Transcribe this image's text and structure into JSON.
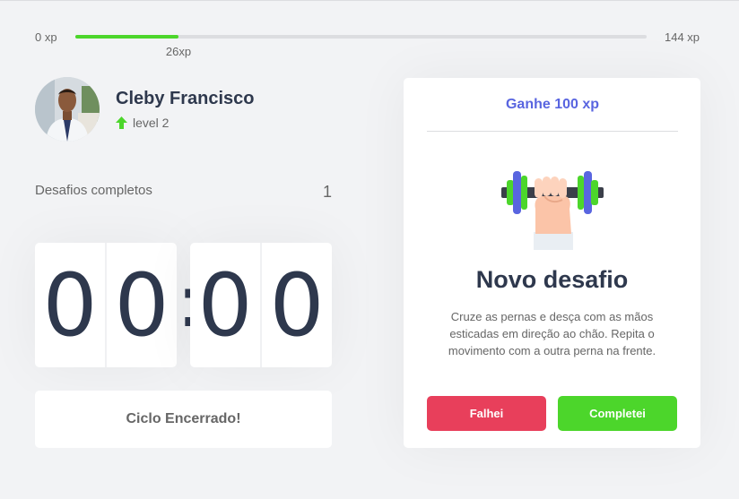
{
  "experience": {
    "min_label": "0 xp",
    "max_label": "144 xp",
    "current_label": "26xp",
    "current": 26,
    "max": 144
  },
  "profile": {
    "name": "Cleby Francisco",
    "level_label": "level 2",
    "avatar": "profile-photo"
  },
  "completed_challenges": {
    "label": "Desafios completos",
    "count": "1"
  },
  "countdown": {
    "minute_left": "0",
    "minute_right": "0",
    "separator": ":",
    "second_left": "0",
    "second_right": "0"
  },
  "cycle_button": {
    "label": "Ciclo Encerrado!"
  },
  "challenge": {
    "header": "Ganhe 100 xp",
    "icon": "dumbbell-icon",
    "title": "Novo desafio",
    "description": "Cruze as pernas e desça com as mãos esticadas em direção ao chão. Repita o movimento com a outra perna na frente.",
    "fail_label": "Falhei",
    "success_label": "Completei"
  },
  "colors": {
    "background": "#f2f3f5",
    "text": "#666666",
    "title": "#2e384d",
    "blue": "#5965e0",
    "green": "#4cd62b",
    "red": "#e83f5b"
  }
}
